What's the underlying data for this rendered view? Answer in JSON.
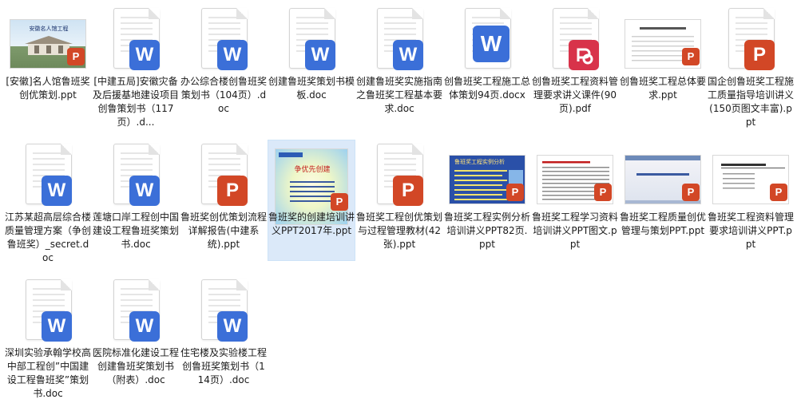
{
  "files": [
    {
      "name": "[安徽]名人馆鲁班奖创优策划.ppt",
      "type": "ppt",
      "thumb": "building"
    },
    {
      "name": "[中建五局]安徽灾备及后援基地建设项目创鲁策划书（117页）.d...",
      "type": "doc"
    },
    {
      "name": "办公综合楼创鲁班奖策划书（104页）.doc",
      "type": "doc"
    },
    {
      "name": "创建鲁班奖策划书模板.doc",
      "type": "doc"
    },
    {
      "name": "创建鲁班奖实施指南之鲁班奖工程基本要求.doc",
      "type": "doc"
    },
    {
      "name": "创鲁班奖工程施工总体策划94页.docx",
      "type": "docx"
    },
    {
      "name": "创鲁班奖工程资料管理要求讲义课件(90页).pdf",
      "type": "pdf"
    },
    {
      "name": "创鲁班奖工程总体要求.ppt",
      "type": "ppt",
      "thumb": "text-title"
    },
    {
      "name": "国企创鲁班奖工程施工质量指导培训讲义(150页图文丰富).ppt",
      "type": "ppt"
    },
    {
      "name": "江苏某超高层综合楼质量管理方案（争创鲁班奖）_secret.doc",
      "type": "doc"
    },
    {
      "name": "莲塘口岸工程创中国建设工程鲁班奖策划书.doc",
      "type": "doc"
    },
    {
      "name": "鲁班奖创优策划流程详解报告(中建系统).ppt",
      "type": "ppt"
    },
    {
      "name": "鲁班奖的创建培训讲义PPT2017年.ppt",
      "type": "ppt",
      "thumb": "blue-slide",
      "selected": true
    },
    {
      "name": "鲁班奖工程创优策划与过程管理教材(42张).ppt",
      "type": "ppt"
    },
    {
      "name": "鲁班奖工程实例分析培训讲义PPT82页.ppt",
      "type": "ppt",
      "thumb": "dark-slide"
    },
    {
      "name": "鲁班奖工程学习资料培训讲义PPT图文.ppt",
      "type": "ppt",
      "thumb": "text-red"
    },
    {
      "name": "鲁班奖工程质量创优管理与策划PPT.ppt",
      "type": "ppt",
      "thumb": "grey-title"
    },
    {
      "name": "鲁班奖工程资料管理要求培训讲义PPT.ppt",
      "type": "ppt",
      "thumb": "text-list"
    },
    {
      "name": "深圳实验承翰学校高中部工程创”中国建设工程鲁班奖”策划书.doc",
      "type": "doc"
    },
    {
      "name": "医院标准化建设工程创建鲁班奖策划书（附表）.doc",
      "type": "doc"
    },
    {
      "name": "住宅楼及实验楼工程创鲁班奖策划书（114页）.doc",
      "type": "doc"
    }
  ],
  "thumb_text": {
    "building_title": "安徽名人馆工程",
    "blue_slide_title": "争优先创建",
    "dark_slide_title": "鲁班奖工程实例分析",
    "text_red_title": "（一）创鲁班奖工程资料管理要点",
    "grey_title": "工程鲁班奖创优管理与策划",
    "text_list_title": "鲁班奖工程资料管理要求"
  },
  "badge_letters": {
    "doc": "W",
    "ppt": "P"
  },
  "colors": {
    "word": "#3b6fd8",
    "ppt": "#d24726",
    "pdf": "#d8334a",
    "selected": "#dbe9f9"
  }
}
